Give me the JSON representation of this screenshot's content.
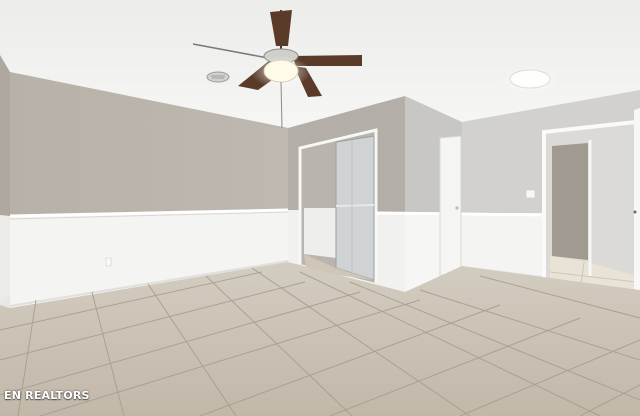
{
  "watermark": {
    "text": "EN REALTORS"
  },
  "colors": {
    "ceiling": "#f1f0ee",
    "upper_wall": "#b7b3ad",
    "wainscot": "#f4f4f2",
    "floor": "#c9c0b3",
    "floor_grout": "#9d9286",
    "door": "#f2f2f0",
    "fan_blade": "#5a3b2a",
    "fan_light": "#fffbe8"
  },
  "icons": {
    "fan": "ceiling-fan-icon",
    "light": "ceiling-light-icon"
  }
}
